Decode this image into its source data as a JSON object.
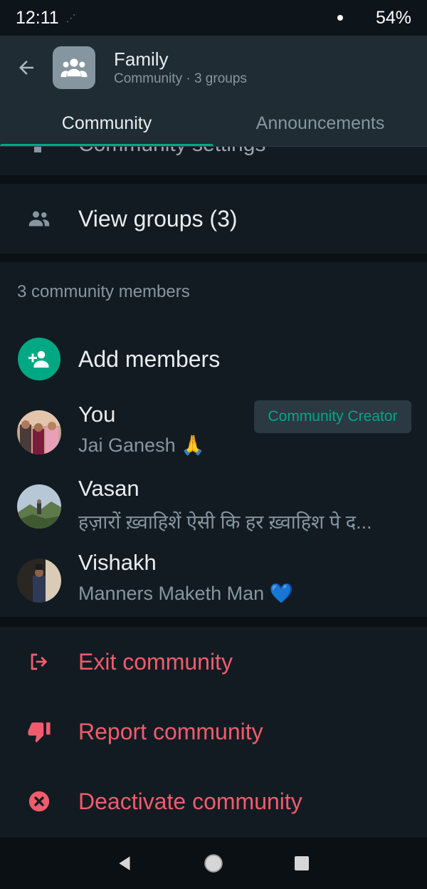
{
  "status_bar": {
    "time": "12:11",
    "battery": "54%"
  },
  "header": {
    "title": "Family",
    "subtitle": "Community · 3 groups",
    "back_icon": "arrow-left-icon",
    "avatar_icon": "group-icon"
  },
  "tabs": [
    {
      "label": "Community",
      "active": true
    },
    {
      "label": "Announcements",
      "active": false
    }
  ],
  "cut_off_item": {
    "label": "Community settings"
  },
  "view_groups": {
    "label": "View groups (3)",
    "icon": "groups-icon"
  },
  "members_section": {
    "header": "3 community members",
    "add_label": "Add members",
    "members": [
      {
        "name": "You",
        "about": "Jai Ganesh 🙏",
        "badge": "Community Creator"
      },
      {
        "name": "Vasan",
        "about": "हज़ारों ख़्वाहिशें ऐसी कि हर ख़्वाहिश पे द..."
      },
      {
        "name": "Vishakh",
        "about": "Manners Maketh Man 💙"
      }
    ]
  },
  "actions": [
    {
      "label": "Exit community",
      "icon": "exit-icon"
    },
    {
      "label": "Report community",
      "icon": "thumbs-down-icon"
    },
    {
      "label": "Deactivate community",
      "icon": "x-circle-icon"
    }
  ],
  "colors": {
    "accent": "#00a884",
    "danger": "#f15c6d",
    "background": "#121b22",
    "header": "#1f2c34"
  }
}
